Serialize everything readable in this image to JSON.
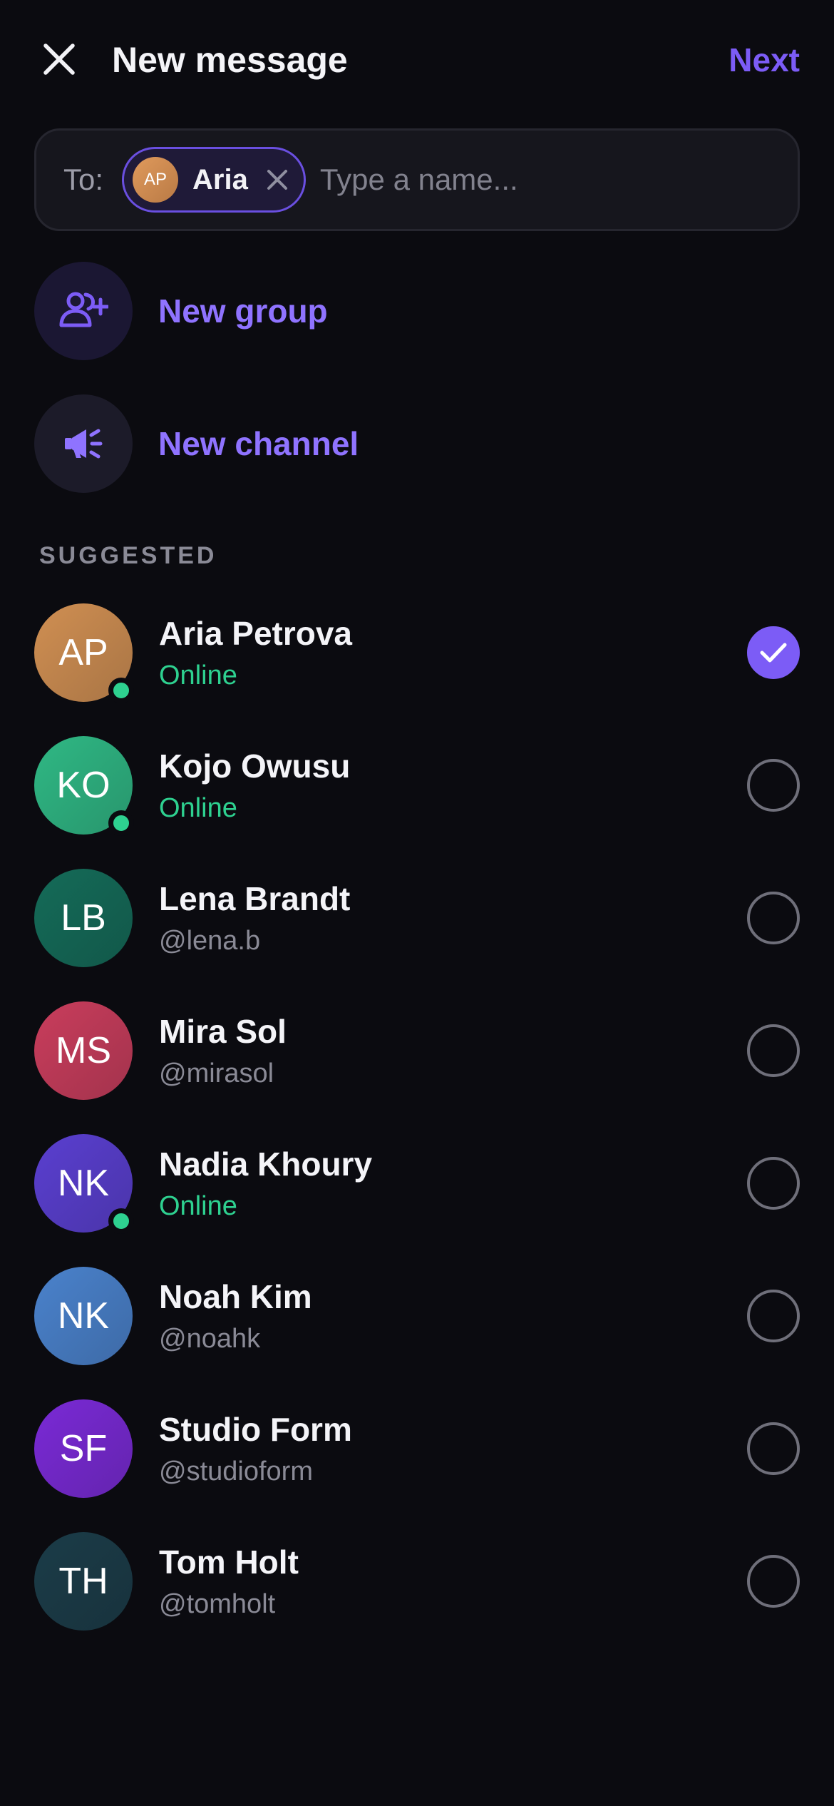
{
  "header": {
    "title": "New message",
    "next_label": "Next"
  },
  "to_field": {
    "label": "To:",
    "chip": {
      "initials": "AP",
      "name": "Aria"
    },
    "placeholder": "Type a name..."
  },
  "actions": [
    {
      "label": "New group",
      "icon": "group-add-icon"
    },
    {
      "label": "New channel",
      "icon": "megaphone-icon"
    }
  ],
  "section_label": "SUGGESTED",
  "contacts": [
    {
      "initials": "AP",
      "name": "Aria Petrova",
      "sub": "Online",
      "online": true,
      "selected": true,
      "color": "#d08f52"
    },
    {
      "initials": "KO",
      "name": "Kojo Owusu",
      "sub": "Online",
      "online": true,
      "selected": false,
      "color": "#2fb884"
    },
    {
      "initials": "LB",
      "name": "Lena Brandt",
      "sub": "@lena.b",
      "online": false,
      "selected": false,
      "color": "#146b58"
    },
    {
      "initials": "MS",
      "name": "Mira Sol",
      "sub": "@mirasol",
      "online": false,
      "selected": false,
      "color": "#c93d5c"
    },
    {
      "initials": "NK",
      "name": "Nadia Khoury",
      "sub": "Online",
      "online": true,
      "selected": false,
      "color": "#5a3fd0"
    },
    {
      "initials": "NK",
      "name": "Noah Kim",
      "sub": "@noahk",
      "online": false,
      "selected": false,
      "color": "#4a82cc"
    },
    {
      "initials": "SF",
      "name": "Studio Form",
      "sub": "@studioform",
      "online": false,
      "selected": false,
      "color": "#7a2ad6"
    },
    {
      "initials": "TH",
      "name": "Tom Holt",
      "sub": "@tomholt",
      "online": false,
      "selected": false,
      "color": "#1b3c48"
    }
  ],
  "colors": {
    "accent": "#7c5cf6",
    "online": "#2ed190",
    "background": "#0b0b10"
  }
}
